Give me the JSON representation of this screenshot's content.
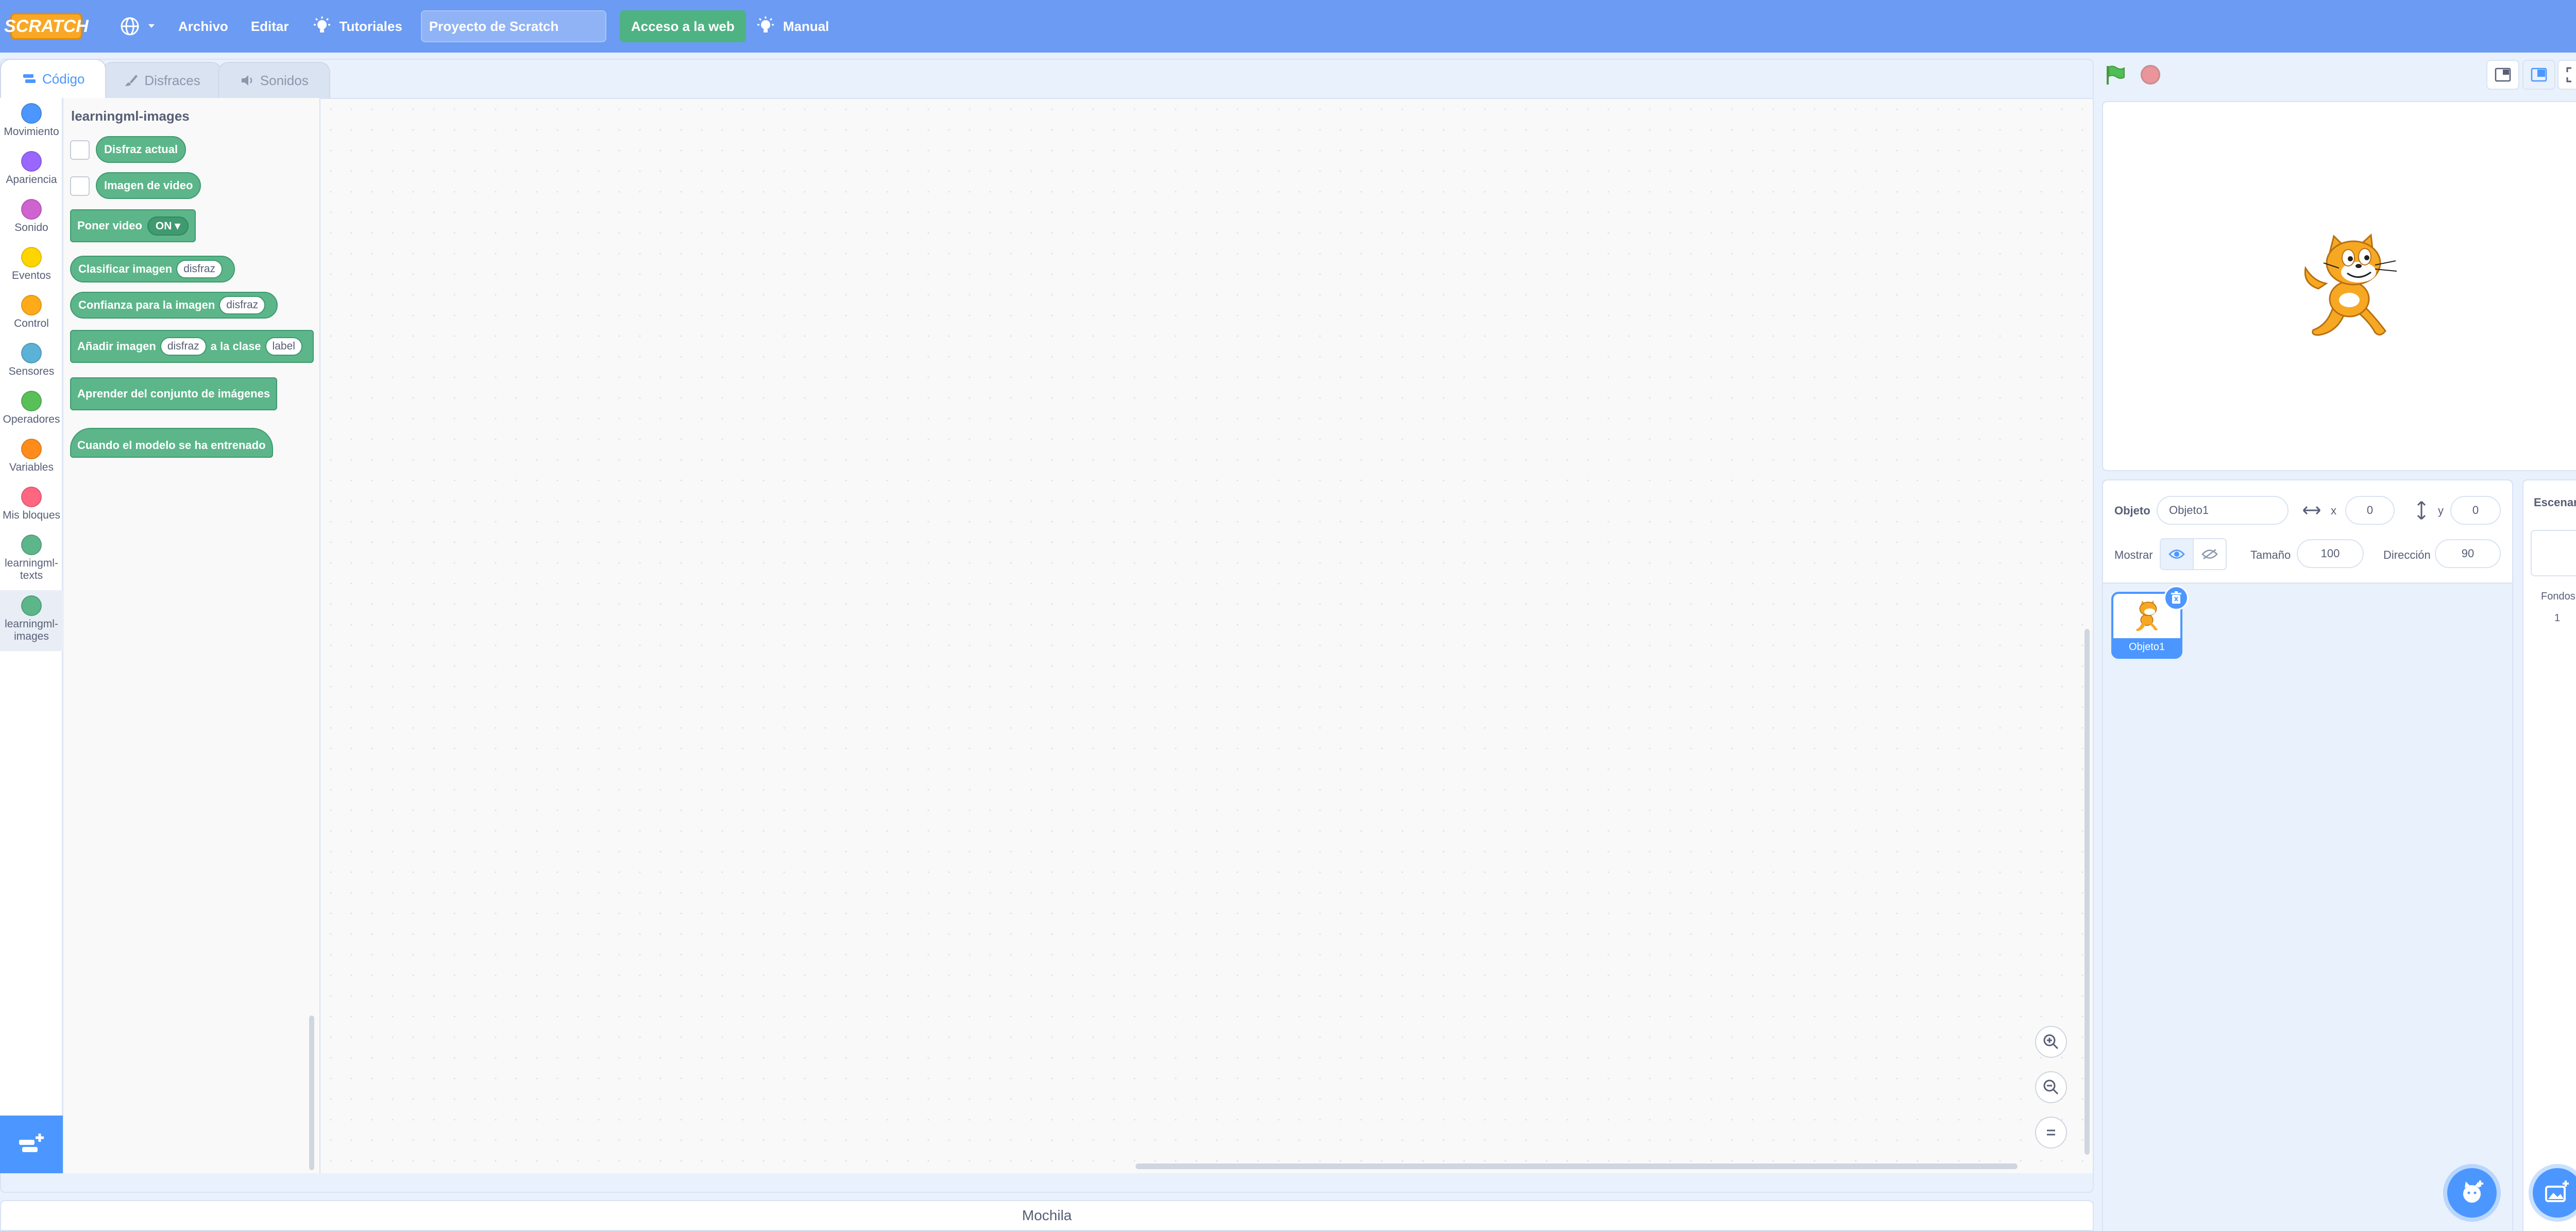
{
  "menubar": {
    "logo_text": "SCRATCH",
    "file": "Archivo",
    "edit": "Editar",
    "tutorials": "Tutoriales",
    "project_title": "Proyecto de Scratch",
    "share": "Acceso a la web",
    "manual": "Manual"
  },
  "tabs": [
    {
      "label": "Código"
    },
    {
      "label": "Disfraces"
    },
    {
      "label": "Sonidos"
    }
  ],
  "categories": [
    {
      "label": "Movimiento",
      "color": "#4c97ff"
    },
    {
      "label": "Apariencia",
      "color": "#9966ff"
    },
    {
      "label": "Sonido",
      "color": "#cf63cf"
    },
    {
      "label": "Eventos",
      "color": "#ffd500"
    },
    {
      "label": "Control",
      "color": "#ffab19"
    },
    {
      "label": "Sensores",
      "color": "#5cb1d6"
    },
    {
      "label": "Operadores",
      "color": "#59c059"
    },
    {
      "label": "Variables",
      "color": "#ff8c1a"
    },
    {
      "label": "Mis bloques",
      "color": "#ff6680"
    },
    {
      "label": "learningml-texts",
      "color": "#5cb68a"
    },
    {
      "label": "learningml-images",
      "color": "#5cb68a"
    }
  ],
  "flyout": {
    "title": "learningml-images",
    "blocks": {
      "current_costume": "Disfraz actual",
      "video_image": "Imagen de video",
      "set_video": "Poner video",
      "set_video_value": "ON ▾",
      "classify": "Clasificar imagen",
      "classify_arg": "disfraz",
      "confidence": "Confianza para la imagen",
      "confidence_arg": "disfraz",
      "add_image": "Añadir imagen",
      "add_image_arg": "disfraz",
      "to_class": "a la clase",
      "to_class_arg": "label",
      "learn": "Aprender del conjunto de imágenes",
      "when_trained": "Cuando el modelo se ha entrenado"
    }
  },
  "backpack": "Mochila",
  "sprite_info": {
    "sprite_label": "Objeto",
    "sprite_name": "Objeto1",
    "x_label": "x",
    "x_value": "0",
    "y_label": "y",
    "y_value": "0",
    "show_label": "Mostrar",
    "size_label": "Tamaño",
    "size_value": "100",
    "direction_label": "Dirección",
    "direction_value": "90"
  },
  "sprites": [
    {
      "name": "Objeto1"
    }
  ],
  "stage_pane": {
    "title": "Escenario",
    "backdrops_label": "Fondos",
    "backdrops_count": "1"
  },
  "colors": {
    "menubar": "#6b9bf2",
    "accent": "#4c97ff",
    "block": "#5cb68a"
  }
}
